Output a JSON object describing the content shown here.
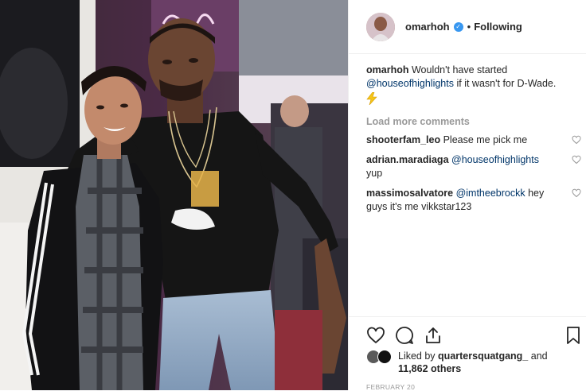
{
  "header": {
    "username": "omarhoh",
    "separator": "•",
    "follow_label": "Following"
  },
  "caption": {
    "username": "omarhoh",
    "text_before": "Wouldn't have started",
    "mention": "@houseofhighlights",
    "text_after": "if it wasn't for D-Wade.",
    "emoji_icon": "high-voltage-icon"
  },
  "load_more_label": "Load more comments",
  "comments": [
    {
      "username": "shooterfam_leo",
      "mention": "",
      "text": "Please me pick me"
    },
    {
      "username": "adrian.maradiaga",
      "mention": "@houseofhighlights",
      "text": "yup"
    },
    {
      "username": "massimosalvatore",
      "mention": "@imtheebrockk",
      "text": "hey guys it's me vikkstar123"
    }
  ],
  "likes": {
    "prefix": "Liked by",
    "username": "quartersquatgang_",
    "suffix": "and",
    "others": "11,862 others"
  },
  "date": "FEBRUARY 20",
  "colors": {
    "link": "#003569",
    "verified": "#3897f0",
    "muted": "#999999"
  }
}
